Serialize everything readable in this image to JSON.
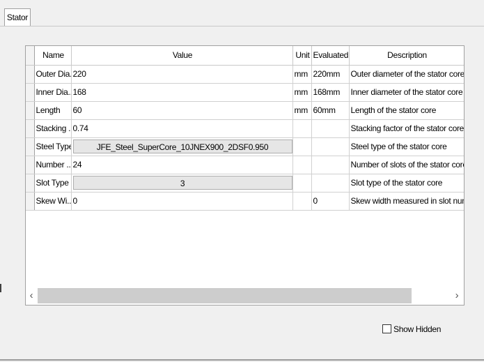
{
  "tabs": [
    {
      "label": "Stator",
      "active": true
    }
  ],
  "grid": {
    "columns": [
      "Name",
      "Value",
      "Unit",
      "Evaluated...",
      "Description"
    ],
    "rows": [
      {
        "name": "Outer Dia...",
        "value": "220",
        "unit": "mm",
        "evaluated": "220mm",
        "description": "Outer diameter of the stator core",
        "value_is_button": false
      },
      {
        "name": "Inner Dia...",
        "value": "168",
        "unit": "mm",
        "evaluated": "168mm",
        "description": "Inner diameter of the stator core",
        "value_is_button": false
      },
      {
        "name": "Length",
        "value": "60",
        "unit": "mm",
        "evaluated": "60mm",
        "description": "Length of the stator core",
        "value_is_button": false
      },
      {
        "name": "Stacking ...",
        "value": "0.74",
        "unit": "",
        "evaluated": "",
        "description": "Stacking factor of the stator core",
        "value_is_button": false
      },
      {
        "name": "Steel Type",
        "value": "JFE_Steel_SuperCore_10JNEX900_2DSF0.950",
        "unit": "",
        "evaluated": "",
        "description": "Steel type of the stator core",
        "value_is_button": true
      },
      {
        "name": "Number ...",
        "value": "24",
        "unit": "",
        "evaluated": "",
        "description": "Number of slots of the stator core",
        "value_is_button": false
      },
      {
        "name": "Slot Type",
        "value": "3",
        "unit": "",
        "evaluated": "",
        "description": "Slot type of the stator core",
        "value_is_button": true
      },
      {
        "name": "Skew Wi...",
        "value": "0",
        "unit": "",
        "evaluated": "0",
        "description": "Skew width measured in slot number",
        "value_is_button": false
      }
    ]
  },
  "scrollbar": {
    "left_arrow": "‹",
    "right_arrow": "›"
  },
  "show_hidden": {
    "label": "Show Hidden",
    "checked": false
  }
}
